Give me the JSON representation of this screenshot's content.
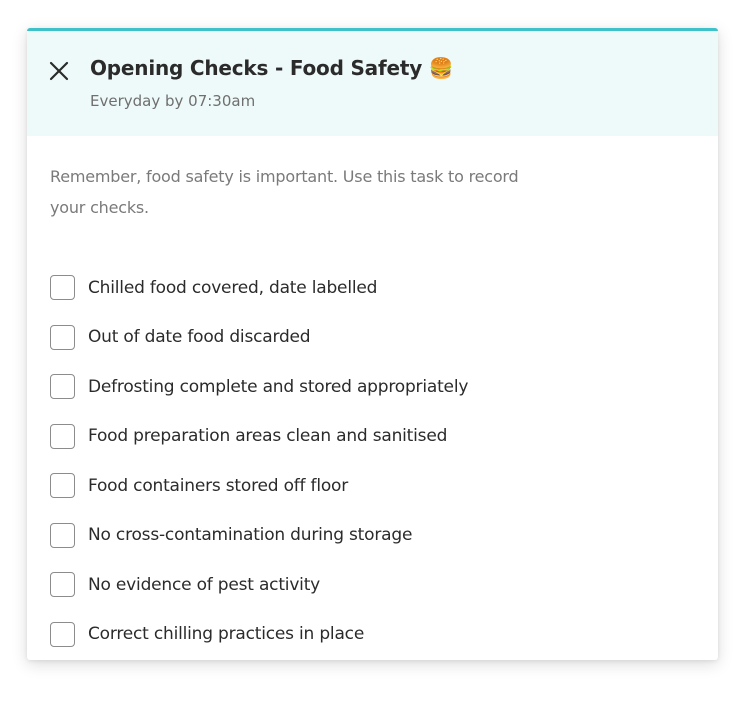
{
  "task": {
    "title": "Opening Checks - Food Safety 🍔",
    "schedule": "Everyday by 07:30am",
    "description": "Remember, food safety is important. Use this task to record your checks.",
    "accent_color": "#3fc1c9",
    "header_bg": "#eefaf9",
    "close_icon": "close-icon"
  },
  "checklist": [
    {
      "label": "Chilled food covered, date labelled",
      "checked": false
    },
    {
      "label": "Out of date food discarded",
      "checked": false
    },
    {
      "label": "Defrosting complete and stored appropriately",
      "checked": false
    },
    {
      "label": "Food preparation areas clean and sanitised",
      "checked": false
    },
    {
      "label": "Food containers stored off floor",
      "checked": false
    },
    {
      "label": "No cross-contamination during storage",
      "checked": false
    },
    {
      "label": "No evidence of pest activity",
      "checked": false
    },
    {
      "label": "Correct chilling practices in place",
      "checked": false
    }
  ]
}
